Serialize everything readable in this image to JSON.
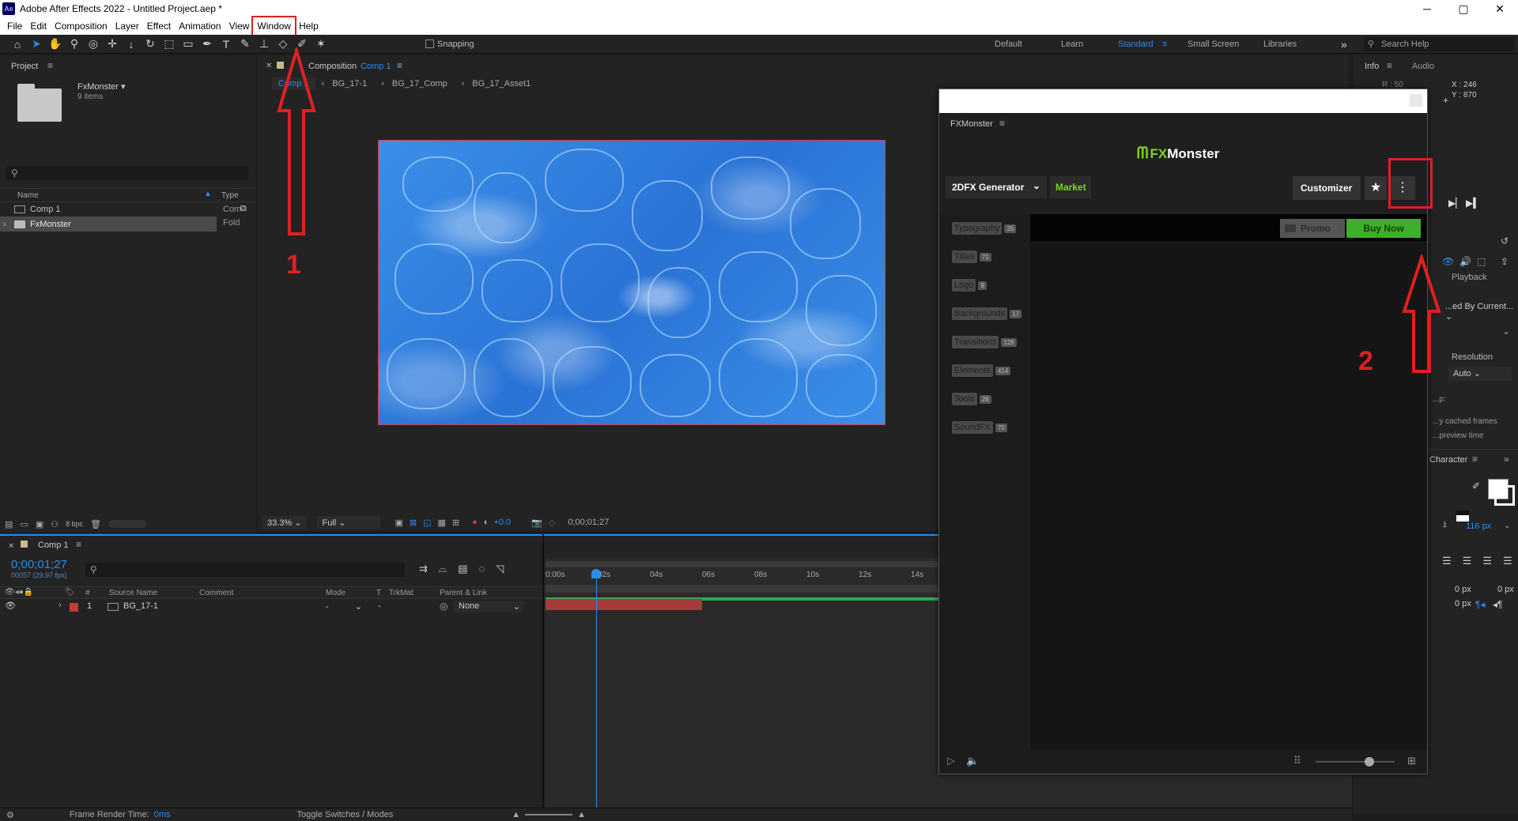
{
  "app": {
    "logo": "Ae",
    "title": "Adobe After Effects 2022 - Untitled Project.aep *"
  },
  "window_controls": {
    "minimize": "─",
    "maximize": "▢",
    "close": "✕"
  },
  "menu": [
    "File",
    "Edit",
    "Composition",
    "Layer",
    "Effect",
    "Animation",
    "View",
    "Window",
    "Help"
  ],
  "toolbar": {
    "snapping_label": "Snapping",
    "workspaces": [
      "Default",
      "Learn",
      "Standard",
      "Small Screen",
      "Libraries"
    ],
    "active_workspace": "Standard",
    "more": "»",
    "search_placeholder": "Search Help"
  },
  "project_panel": {
    "tab": "Project",
    "folder_name": "FxMonster ▾",
    "folder_items": "9 items",
    "search_placeholder": "",
    "col_name": "Name",
    "col_type": "Type",
    "items": [
      {
        "name": "Comp 1",
        "type": "Com"
      },
      {
        "name": "FxMonster",
        "type": "Fold"
      }
    ],
    "bpc": "8 bpc"
  },
  "composition_panel": {
    "tab_prefix": "Composition",
    "tab_name": "Comp 1",
    "breadcrumbs": [
      "Comp 1",
      "BG_17-1",
      "BG_17_Comp",
      "BG_17_Asset1"
    ],
    "zoom": "33.3%",
    "resolution": "Full",
    "exposure": "+0.0",
    "timecode": "0;00;01;27"
  },
  "info_panel": {
    "tabs": [
      "Info",
      "Audio"
    ],
    "r_value": "R : 50",
    "x_value": "X : 246",
    "y_value": "Y : 870"
  },
  "preview_panel": {
    "playback_label": "Playback",
    "range_option": "...ed By Current...",
    "resolution_label": "Resolution",
    "resolution_value": "Auto",
    "cache_line1": "...p:",
    "cache_line2": "...y cached frames",
    "cache_line3": "...preview time"
  },
  "character_panel": {
    "tab": "Character",
    "tracking": "116 px",
    "indent1": "0 px",
    "indent2": "0 px",
    "indent3": "0 px"
  },
  "timeline": {
    "tab": "Comp 1",
    "current_time": "0;00;01;27",
    "frame_info": "00057 (29.97 fps)",
    "columns": [
      "#",
      "Source Name",
      "Comment",
      "Mode",
      "T",
      "TrkMat",
      "Parent & Link"
    ],
    "ruler": [
      "0:00s",
      "02s",
      "04s",
      "06s",
      "08s",
      "10s",
      "12s",
      "14s"
    ],
    "layers": [
      {
        "index": "1",
        "name": "BG_17-1",
        "mode": "-",
        "trkmat": "-",
        "parent": "None",
        "color": "#c43b3b"
      }
    ],
    "frame_render_label": "Frame Render Time:",
    "frame_render_value": "0ms",
    "toggle_label": "Toggle Switches / Modes"
  },
  "plugin": {
    "panel_title": "FXMonster",
    "brand": "FXMonster",
    "brand_prefix": "FX",
    "brand_suffix": "Monster",
    "brand_color": "#7ed321",
    "generator_label": "2DFX Generator",
    "market_label": "Market",
    "customizer_label": "Customizer",
    "promo_label": "Promo",
    "buy_label": "Buy Now",
    "categories": [
      {
        "label": "Typography",
        "count": "25"
      },
      {
        "label": "Titles",
        "count": "71"
      },
      {
        "label": "Logo",
        "count": "9"
      },
      {
        "label": "Backgrounds",
        "count": "17"
      },
      {
        "label": "Transitions",
        "count": "128"
      },
      {
        "label": "Elements",
        "count": "414"
      },
      {
        "label": "Tools",
        "count": "28"
      },
      {
        "label": "SoundFX",
        "count": "70"
      }
    ]
  },
  "annotations": [
    {
      "label": "1",
      "color": "#e02020"
    },
    {
      "label": "2",
      "color": "#e02020"
    }
  ]
}
